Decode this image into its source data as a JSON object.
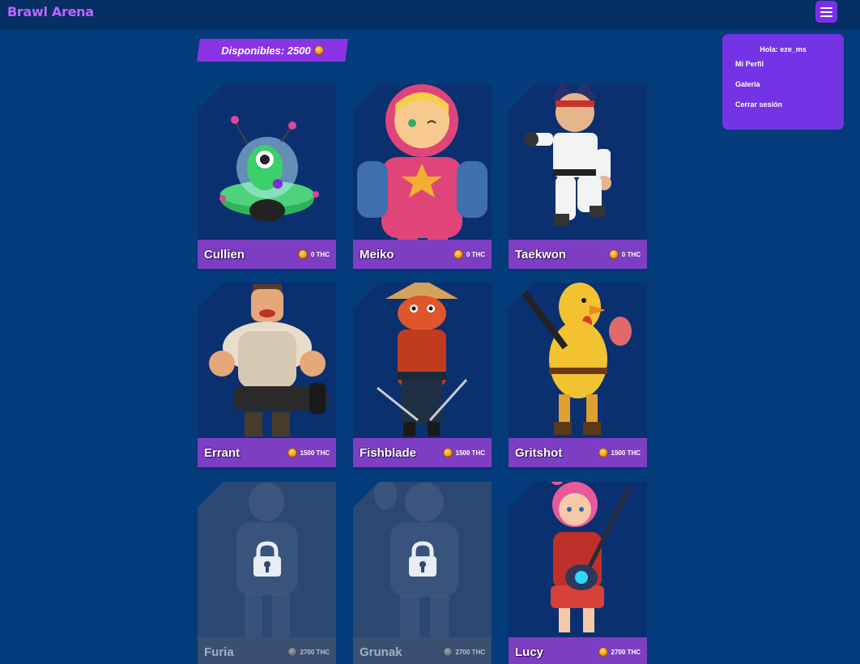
{
  "app": {
    "title": "Brawl Arena"
  },
  "balance": {
    "label": "Disponibles: 2500"
  },
  "dropdown": {
    "greeting": "Hola: eze_ms",
    "items": [
      {
        "label": "Mi Perfil"
      },
      {
        "label": "Galería"
      },
      {
        "label": "Cerrar sesión"
      }
    ]
  },
  "icons": {
    "menu": "hamburger-menu-icon",
    "coin": "coin-icon",
    "lock": "lock-icon"
  },
  "colors": {
    "background": "#043b7a",
    "accent": "#7b2ee8",
    "brand": "#c066ff",
    "card_footer": "#7e3ec4",
    "locked_card": "#2b4873"
  },
  "characters": [
    {
      "name": "Cullien",
      "price": "0 THC",
      "locked": false
    },
    {
      "name": "Meiko",
      "price": "0 THC",
      "locked": false
    },
    {
      "name": "Taekwon",
      "price": "0 THC",
      "locked": false
    },
    {
      "name": "Errant",
      "price": "1500 THC",
      "locked": false
    },
    {
      "name": "Fishblade",
      "price": "1500 THC",
      "locked": false
    },
    {
      "name": "Gritshot",
      "price": "1500 THC",
      "locked": false
    },
    {
      "name": "Furia",
      "price": "2700 THC",
      "locked": true
    },
    {
      "name": "Grunak",
      "price": "2700 THC",
      "locked": true
    },
    {
      "name": "Lucy",
      "price": "2700 THC",
      "locked": false
    }
  ]
}
